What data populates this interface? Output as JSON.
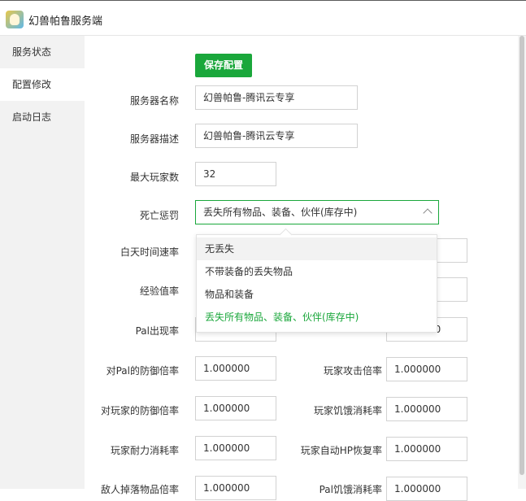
{
  "app": {
    "title": "幻兽帕鲁服务端",
    "icon": "app-logo-icon"
  },
  "sidebar": {
    "items": [
      {
        "label": "服务状态"
      },
      {
        "label": "配置修改"
      },
      {
        "label": "启动日志"
      }
    ]
  },
  "toolbar": {
    "save_label": "保存配置"
  },
  "form": {
    "server_name": {
      "label": "服务器名称",
      "value": "幻兽帕鲁-腾讯云专享"
    },
    "server_desc": {
      "label": "服务器描述",
      "value": "幻兽帕鲁-腾讯云专享"
    },
    "max_players": {
      "label": "最大玩家数",
      "value": "32"
    },
    "death_penalty": {
      "label": "死亡惩罚",
      "value": "丢失所有物品、装备、伙伴(库存中)"
    },
    "day_speed": {
      "label": "白天时间速率"
    },
    "exp_rate": {
      "label": "经验值率"
    },
    "pal_spawn": {
      "label": "Pal出现率"
    },
    "pal_defense": {
      "label": "对Pal的防御倍率",
      "value": "1.000000"
    },
    "player_attack": {
      "label": "玩家攻击倍率",
      "value": "1.000000"
    },
    "player_defense": {
      "label": "对玩家的防御倍率",
      "value": "1.000000"
    },
    "player_hunger": {
      "label": "玩家饥饿消耗率",
      "value": "1.000000"
    },
    "player_stamina": {
      "label": "玩家耐力消耗率",
      "value": "1.000000"
    },
    "player_hp_regen": {
      "label": "玩家自动HP恢复率",
      "value": "1.000000"
    },
    "enemy_drop": {
      "label": "敌人掉落物品倍率",
      "value": "1.000000"
    },
    "pal_hunger": {
      "label": "Pal饥饿消耗率",
      "value": "1.000000"
    },
    "partial_value": "1.000000"
  },
  "dropdown": {
    "options": [
      {
        "label": "无丢失"
      },
      {
        "label": "不带装备的丢失物品"
      },
      {
        "label": "物品和装备"
      },
      {
        "label": "丢失所有物品、装备、伙伴(库存中)"
      }
    ],
    "selected_index": 3,
    "hover_index": 0
  },
  "colors": {
    "accent": "#1aa73b",
    "sidebar_bg": "#f2f2f2"
  }
}
